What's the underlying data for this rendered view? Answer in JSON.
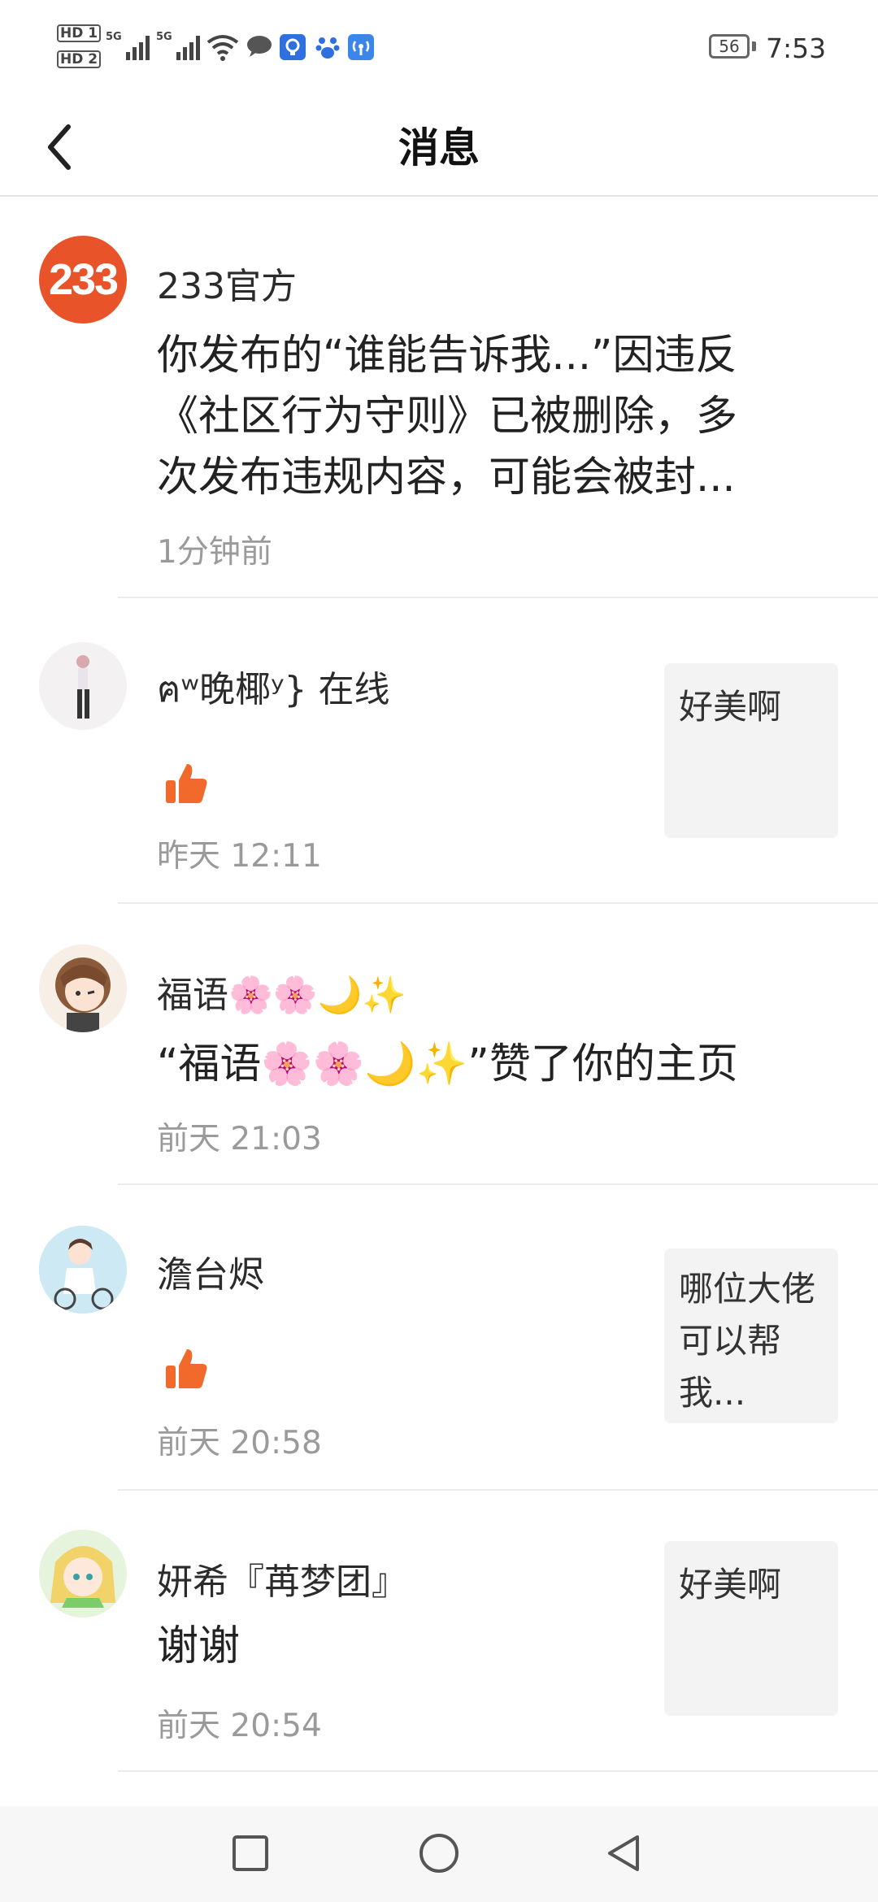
{
  "status_bar": {
    "hd1": "HD 1",
    "hd2": "HD 2",
    "net1": "5G",
    "net2": "5G",
    "wifi_label": "6",
    "battery": "56",
    "time": "7:53"
  },
  "header": {
    "title": "消息",
    "back_icon": "chevron-left-icon"
  },
  "messages": [
    {
      "avatar_text": "233",
      "name": "233官方",
      "content_lines": [
        "你发布的“谁能告诉我...”因违反",
        "《社区行为守则》已被删除，多",
        "次发布违规内容，可能会被封..."
      ],
      "time": "1分钟前"
    },
    {
      "name": "ฅʷ晚椰ʸ} 在线",
      "content_icon": "thumbs-up-icon",
      "time": "昨天 12:11",
      "preview": "好美啊"
    },
    {
      "name": "福语🌸🌸🌙✨",
      "content": "“福语🌸🌸🌙✨”赞了你的主页",
      "time": "前天 21:03"
    },
    {
      "name": "澹台烬",
      "content_icon": "thumbs-up-icon",
      "time": "前天 20:58",
      "preview": "哪位大佬可以帮我..."
    },
    {
      "name": "妍希『苒梦团』",
      "content": "谢谢",
      "time": "前天 20:54",
      "preview": "好美啊"
    }
  ],
  "colors": {
    "accent": "#f26a2b",
    "badge_red": "#e8532a",
    "divider": "#ececec",
    "time_gray": "#9a9a9a"
  }
}
